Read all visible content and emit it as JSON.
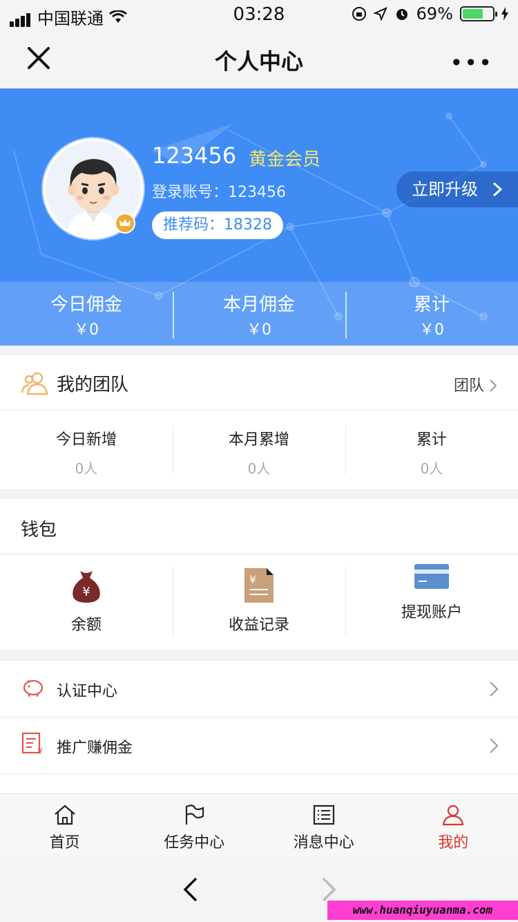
{
  "status_bar": {
    "carrier": "中国联通",
    "time": "03:28",
    "battery_percent": "69%",
    "battery_level": 0.69
  },
  "nav": {
    "title": "个人中心",
    "close_icon": "close-icon",
    "more_label": "•••"
  },
  "profile": {
    "username": "123456",
    "membership": "黄金会员",
    "login_account": "登录账号：123456",
    "referral_code": "推荐码：18328",
    "upgrade_label": "立即升级"
  },
  "earnings": [
    {
      "label": "今日佣金",
      "value": "￥0"
    },
    {
      "label": "本月佣金",
      "value": "￥0"
    },
    {
      "label": "累计",
      "value": "￥0"
    }
  ],
  "team": {
    "title": "我的团队",
    "link_label": "团队",
    "stats": [
      {
        "label": "今日新增",
        "value": "0人"
      },
      {
        "label": "本月累增",
        "value": "0人"
      },
      {
        "label": "累计",
        "value": "0人"
      }
    ]
  },
  "wallet": {
    "title": "钱包",
    "items": [
      {
        "label": "余额",
        "icon": "money-bag-icon"
      },
      {
        "label": "收益记录",
        "icon": "receipt-icon"
      },
      {
        "label": "提现账户",
        "icon": "card-icon"
      }
    ]
  },
  "menu": [
    {
      "label": "认证中心",
      "icon": "piggy-bank-icon"
    },
    {
      "label": "推广赚佣金",
      "icon": "invoice-icon"
    }
  ],
  "tabbar": [
    {
      "label": "首页",
      "icon": "home-icon"
    },
    {
      "label": "任务中心",
      "icon": "flag-icon"
    },
    {
      "label": "消息中心",
      "icon": "list-icon"
    },
    {
      "label": "我的",
      "icon": "user-icon"
    }
  ],
  "colors": {
    "primary": "#3f8cf5",
    "gold": "#f5e66a",
    "active_tab": "#e0322b"
  },
  "watermark": "www.huanqiuyuanma.com"
}
